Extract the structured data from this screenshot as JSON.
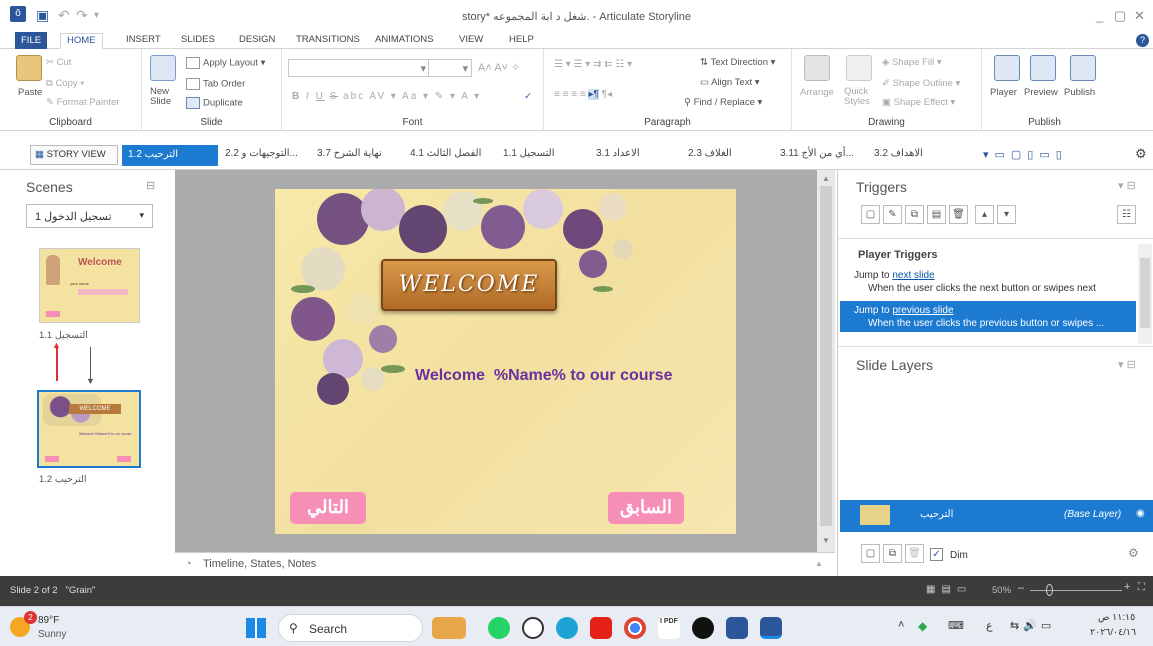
{
  "window": {
    "title": "story* شغل د ابة المجموعه. - Articulate Storyline"
  },
  "ribbon_tabs": [
    "FILE",
    "HOME",
    "INSERT",
    "SLIDES",
    "DESIGN",
    "TRANSITIONS",
    "ANIMATIONS",
    "VIEW",
    "HELP"
  ],
  "clipboard": {
    "paste": "Paste",
    "cut": "Cut",
    "copy": "Copy",
    "format_painter": "Format Painter",
    "label": "Clipboard"
  },
  "slide_group": {
    "new_slide": "New Slide",
    "apply_layout": "Apply Layout",
    "tab_order": "Tab Order",
    "duplicate": "Duplicate",
    "label": "Slide"
  },
  "font_group": {
    "label": "Font",
    "bold": "B",
    "italic": "I",
    "underline": "U",
    "strike": "S",
    "abc": "abc"
  },
  "paragraph_group": {
    "text_direction": "Text Direction",
    "align_text": "Align Text",
    "find_replace": "Find / Replace",
    "label": "Paragraph"
  },
  "drawing_group": {
    "arrange": "Arrange",
    "quick_styles": "Quick Styles",
    "shape_fill": "Shape Fill",
    "shape_outline": "Shape Outline",
    "shape_effect": "Shape Effect",
    "label": "Drawing"
  },
  "publish_group": {
    "player": "Player",
    "preview": "Preview",
    "publish": "Publish",
    "label": "Publish"
  },
  "slide_tabs": [
    "STORY VIEW",
    "الترحيب 1.2",
    "التوجيهات و 2.2...",
    "نهاية الشرح 3.7",
    "الفصل الثالث 4.1",
    "التسجيل 1.1",
    "الاعداد 3.1",
    "الغلاف 2.3",
    "أي من الأج 3.11...",
    "الاهداف 3.2"
  ],
  "scenes": {
    "title": "Scenes",
    "current": "تسجيل الدخول 1",
    "thumbs": [
      {
        "label": "التسجيل 1.1",
        "mini": "Welcome",
        "mini_sub": "your name"
      },
      {
        "label": "الترحيب 1.2",
        "mini": "WELCOME",
        "mini_sub": "Welcome %Name% to our course"
      }
    ]
  },
  "slide": {
    "banner": "WELCOME",
    "welcome_text": "Welcome  %Name% to our course",
    "next_btn": "التالي",
    "prev_btn": "السابق"
  },
  "timeline": {
    "label": "Timeline, States, Notes"
  },
  "triggers": {
    "title": "Triggers",
    "section": "Player Triggers",
    "items": [
      {
        "jump": "Jump to ",
        "link": "next slide",
        "cond": "When the user clicks the next button or swipes next"
      },
      {
        "jump": "Jump to ",
        "link": "previous slide",
        "cond": "When the user clicks the previous button or swipes ..."
      }
    ]
  },
  "layers": {
    "title": "Slide Layers",
    "base_name": "الترحيب",
    "base_label": "(Base Layer)",
    "dim": "Dim"
  },
  "status": {
    "text": "Slide 2 of 2   \"Grain\"",
    "zoom": "50%"
  },
  "taskbar": {
    "temp": "89°F",
    "weather": "Sunny",
    "badge": "2",
    "search": "Search",
    "time": "١١:١٥ ص",
    "date": "٢٠٢٦/٠٤/١٦",
    "lang": "ع",
    "pdf": "I PDF"
  },
  "colors": {
    "accent": "#2b579a",
    "selection": "#1c7ad0",
    "purple": "#6a2fa0",
    "pink": "#f58fb6",
    "status_bg": "#3c3c3c"
  }
}
